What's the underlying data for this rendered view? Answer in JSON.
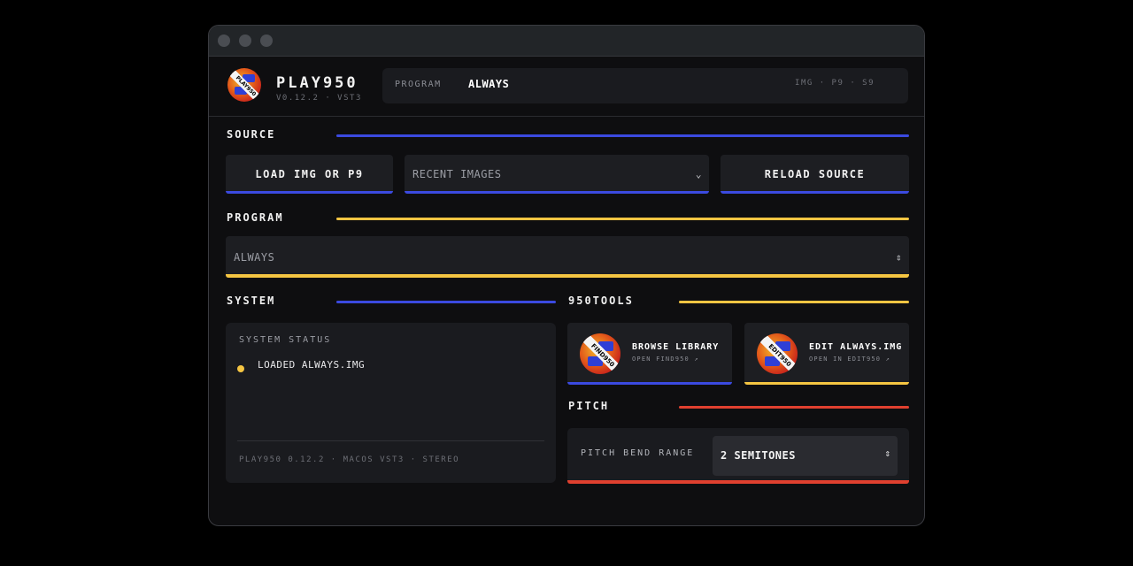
{
  "colors": {
    "blue": "#3b4ae0",
    "yellow": "#f5c542",
    "red": "#e0402f",
    "background": "#0e0e10"
  },
  "header": {
    "app_name": "PLAY950",
    "version_line": "V0.12.2 · VST3",
    "program_label": "PROGRAM",
    "program_value": "ALWAYS",
    "format_info": "IMG · P9 · S9",
    "logo_text": "PLAY950"
  },
  "source": {
    "label": "SOURCE",
    "load_button": "LOAD IMG OR P9",
    "recent_placeholder": "RECENT IMAGES",
    "reload_button": "RELOAD SOURCE"
  },
  "program": {
    "label": "PROGRAM",
    "selected": "ALWAYS"
  },
  "system": {
    "label": "SYSTEM",
    "status_title": "SYSTEM STATUS",
    "status_message": "LOADED ALWAYS.IMG",
    "footer": "PLAY950 0.12.2 · MACOS VST3 · STEREO"
  },
  "tools": {
    "label": "950TOOLS",
    "items": [
      {
        "title": "BROWSE LIBRARY",
        "subtitle": "OPEN FIND950 ↗",
        "logo_text": "FIND950",
        "icon": "find950-logo-icon"
      },
      {
        "title": "EDIT ALWAYS.IMG",
        "subtitle": "OPEN IN EDIT950 ↗",
        "logo_text": "EDIT950",
        "icon": "edit950-logo-icon"
      }
    ]
  },
  "pitch": {
    "label": "PITCH",
    "bend_label": "PITCH BEND RANGE",
    "bend_value": "2 SEMITONES"
  }
}
